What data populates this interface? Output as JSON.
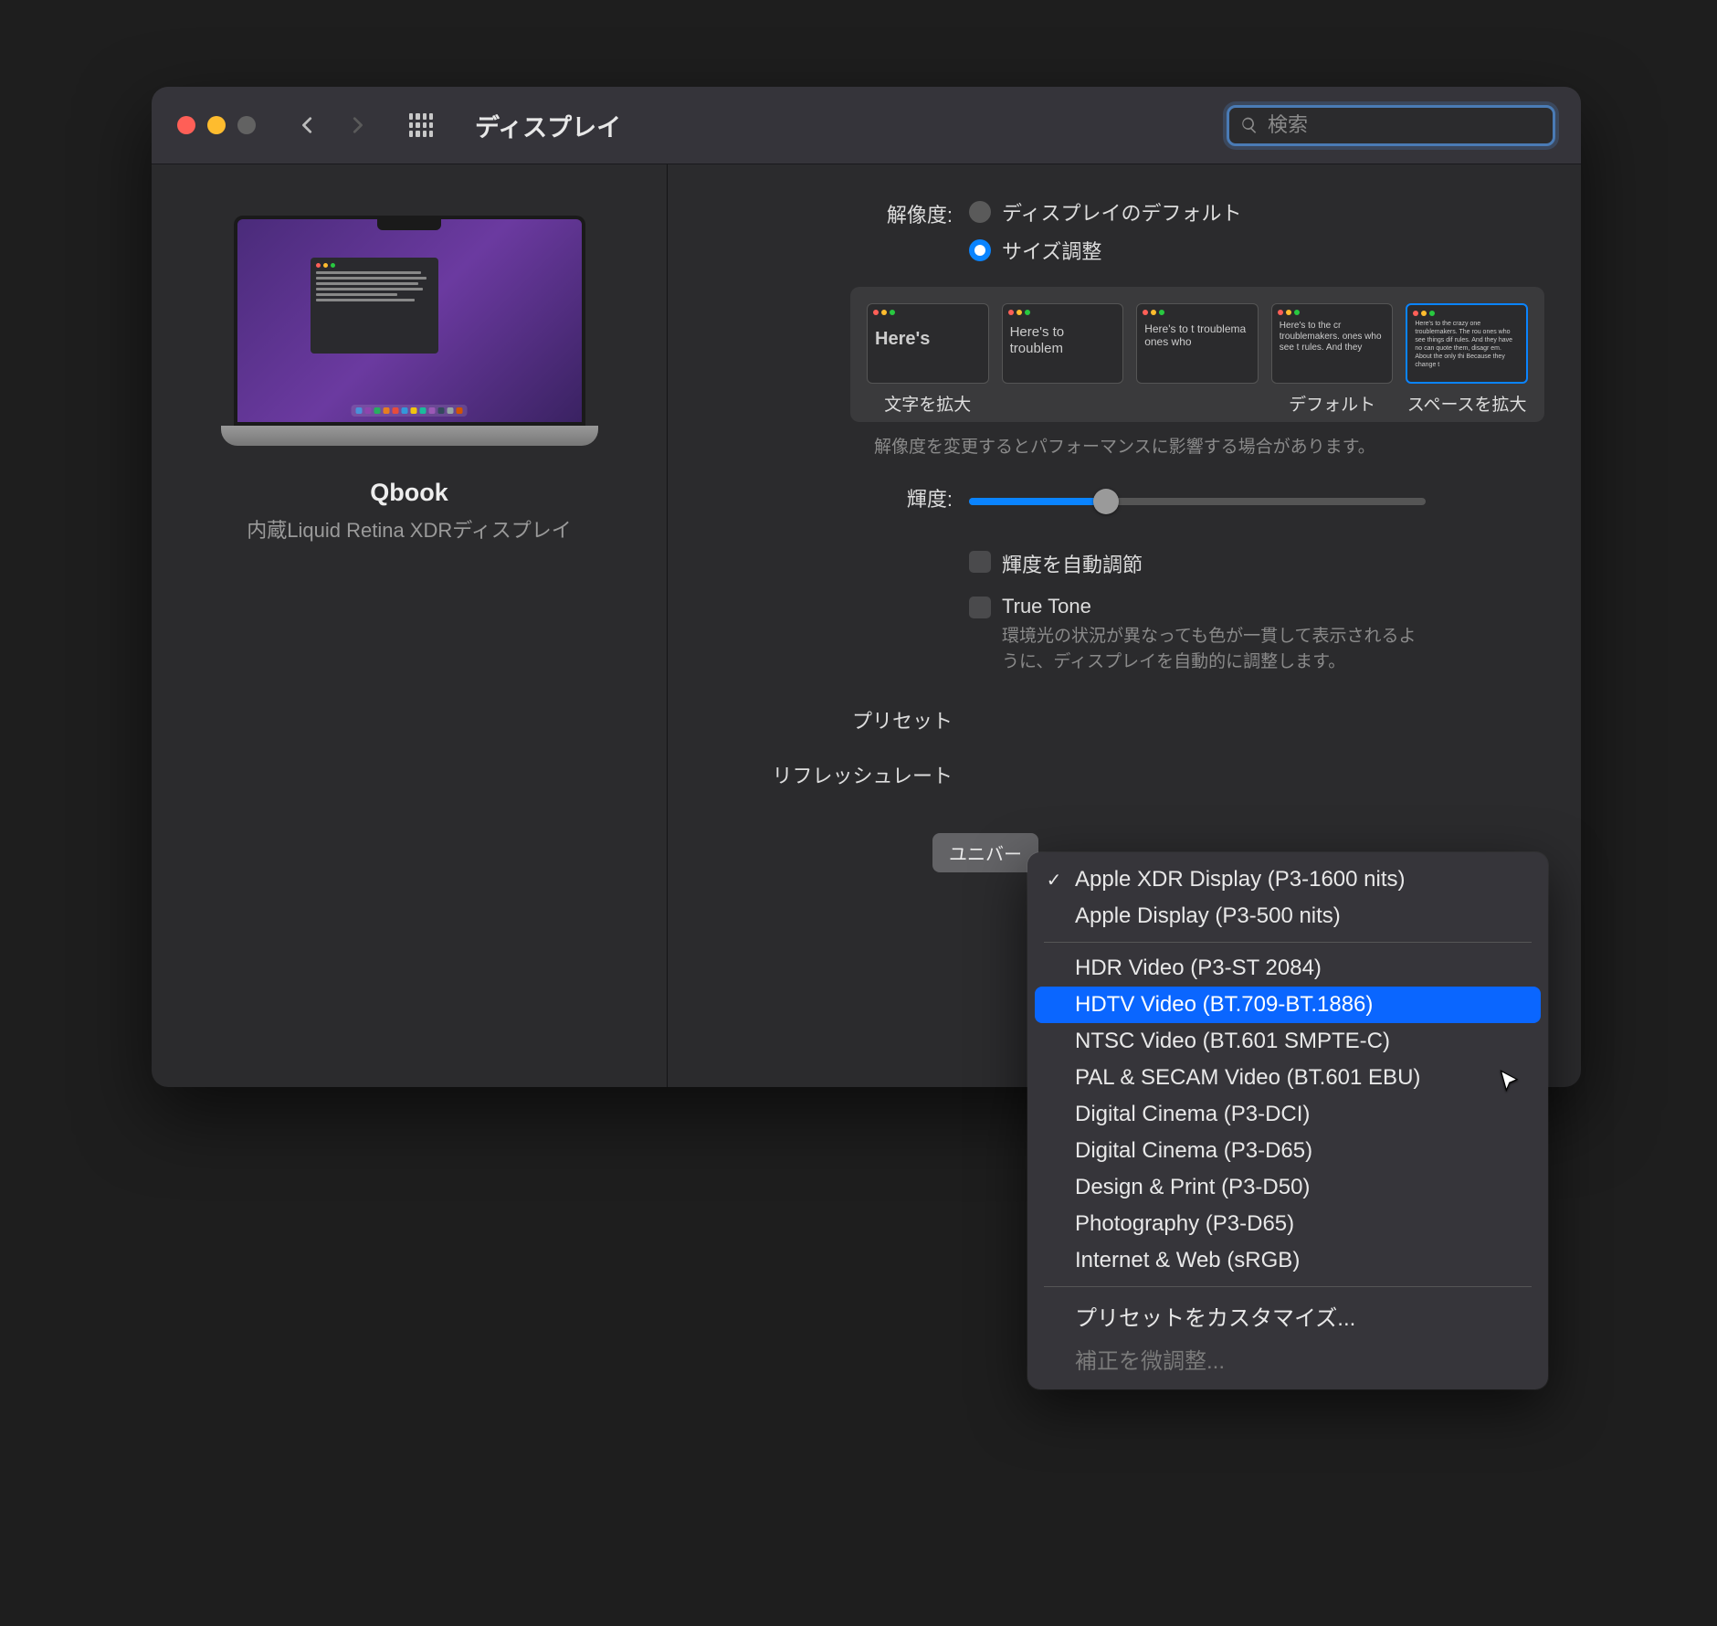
{
  "toolbar": {
    "title": "ディスプレイ",
    "search_placeholder": "検索"
  },
  "sidebar": {
    "display_name": "Qbook",
    "display_sub": "内蔵Liquid Retina XDRディスプレイ"
  },
  "resolution": {
    "label": "解像度:",
    "option_default": "ディスプレイのデフォルト",
    "option_scaled": "サイズ調整",
    "selected": "scaled",
    "scale_text_sample": "Here's to the crazy ones. The misfits. The troublemakers. The ones who see things differently.",
    "scale_samples": [
      "Here's",
      "Here's to troublem",
      "Here's to t troublema ones who",
      "Here's to the cr troublemakers. ones who see t rules. And they",
      "Here's to the crazy one troublemakers. The rou ones who see things dif rules. And they have no can quote them, disagr em. About the only thi Because they change t"
    ],
    "scale_captions": [
      "文字を拡大",
      "",
      "",
      "デフォルト",
      "スペースを拡大"
    ],
    "selected_scale_index": 4,
    "note": "解像度を変更するとパフォーマンスに影響する場合があります。"
  },
  "brightness": {
    "label": "輝度:",
    "value_percent": 30,
    "auto_label": "輝度を自動調節",
    "truetone_label": "True Tone",
    "truetone_note": "環境光の状況が異なっても色が一貫して表示されるように、ディスプレイを自動的に調整します。"
  },
  "preset": {
    "label": "プリセット"
  },
  "refresh": {
    "label": "リフレッシュレート"
  },
  "universal_button": "ユニバー",
  "menu": {
    "items": [
      {
        "label": "Apple XDR Display (P3-1600 nits)",
        "checked": true
      },
      {
        "label": "Apple Display (P3-500 nits)"
      },
      {
        "sep": true
      },
      {
        "label": "HDR Video (P3-ST 2084)"
      },
      {
        "label": "HDTV Video (BT.709-BT.1886)",
        "highlight": true
      },
      {
        "label": "NTSC Video (BT.601 SMPTE-C)"
      },
      {
        "label": "PAL & SECAM Video (BT.601 EBU)"
      },
      {
        "label": "Digital Cinema (P3-DCI)"
      },
      {
        "label": "Digital Cinema (P3-D65)"
      },
      {
        "label": "Design & Print (P3-D50)"
      },
      {
        "label": "Photography (P3-D65)"
      },
      {
        "label": "Internet & Web (sRGB)"
      },
      {
        "sep": true
      },
      {
        "label": "プリセットをカスタマイズ..."
      },
      {
        "label": "補正を微調整...",
        "disabled": true
      }
    ]
  }
}
